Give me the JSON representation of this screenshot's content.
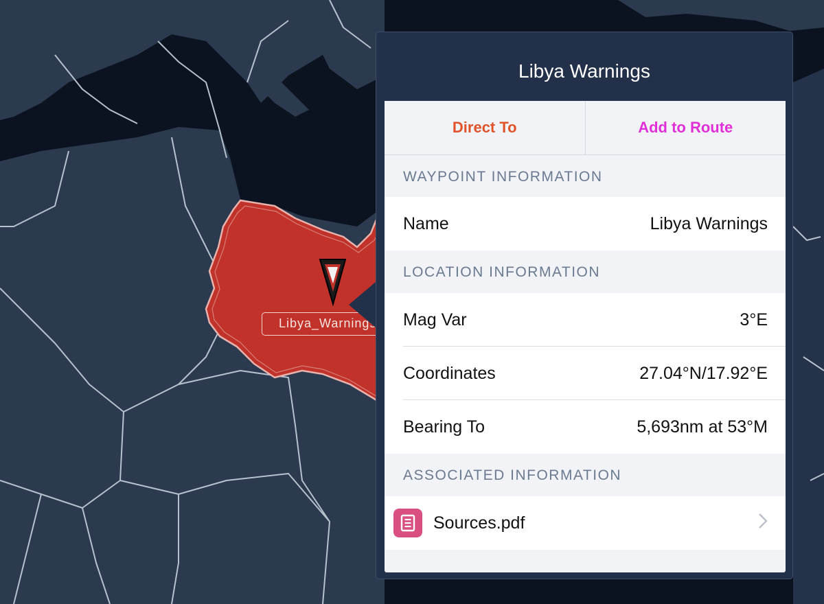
{
  "map": {
    "marker_label": "Libya_Warnings",
    "colors": {
      "water": "#0c1320",
      "land": "#2b3a4f",
      "highlight": "#c0322a"
    }
  },
  "popover": {
    "title": "Libya Warnings",
    "actions": {
      "direct_to": {
        "label": "Direct To",
        "color": "#e0532b"
      },
      "add_to_route": {
        "label": "Add to Route",
        "color": "#e12fd7"
      }
    },
    "sections": {
      "waypoint": "WAYPOINT INFORMATION",
      "location": "LOCATION INFORMATION",
      "associated": "ASSOCIATED INFORMATION"
    },
    "waypoint_rows": [
      {
        "label": "Name",
        "value": "Libya Warnings"
      }
    ],
    "location_rows": [
      {
        "label": "Mag Var",
        "value": "3°E"
      },
      {
        "label": "Coordinates",
        "value": "27.04°N/17.92°E"
      },
      {
        "label": "Bearing To",
        "value": "5,693nm at 53°M"
      }
    ],
    "documents": [
      {
        "name": "Sources.pdf",
        "icon": "document-icon",
        "accessory": "chevron-right-icon"
      }
    ]
  }
}
